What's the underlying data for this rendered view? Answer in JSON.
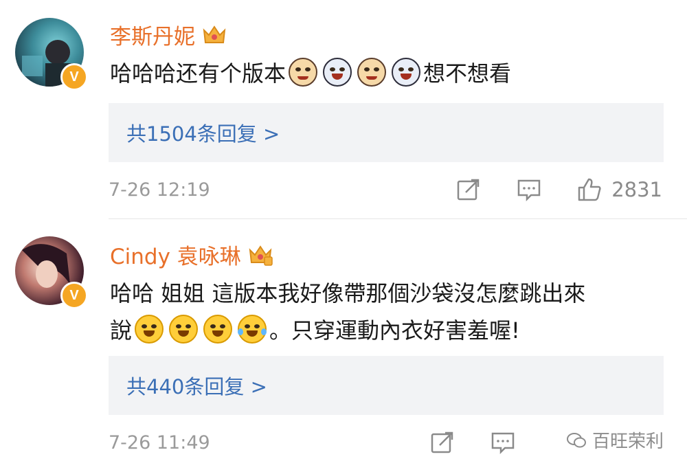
{
  "comments": [
    {
      "username": "李斯丹妮",
      "text_parts": [
        "哈哈哈还有个版本",
        "想不想看"
      ],
      "emojis": [
        "cat-face-icon",
        "dog-face-icon",
        "cat-face-icon",
        "dog-face-icon"
      ],
      "reply_label": "共1504条回复 >",
      "time": "7-26 12:19",
      "likes": "2831"
    },
    {
      "username": "Cindy 袁咏琳",
      "text_line1": "哈哈 姐姐 這版本我好像帶那個沙袋沒怎麼跳出來",
      "text_line2_start": "說",
      "text_line2_end": "。只穿運動內衣好害羞喔!",
      "emojis": [
        "grinning-squint-icon",
        "grinning-squint-icon",
        "grinning-squint-icon",
        "tears-of-joy-icon"
      ],
      "reply_label": "共440条回复 >",
      "time": "7-26 11:49"
    }
  ],
  "verified_badge": "V",
  "watermark": "百旺荣利",
  "colors": {
    "username": "#e8702a",
    "reply_link": "#3b6fb6",
    "badge": "#f5a623",
    "reply_bg": "#f2f3f5"
  }
}
